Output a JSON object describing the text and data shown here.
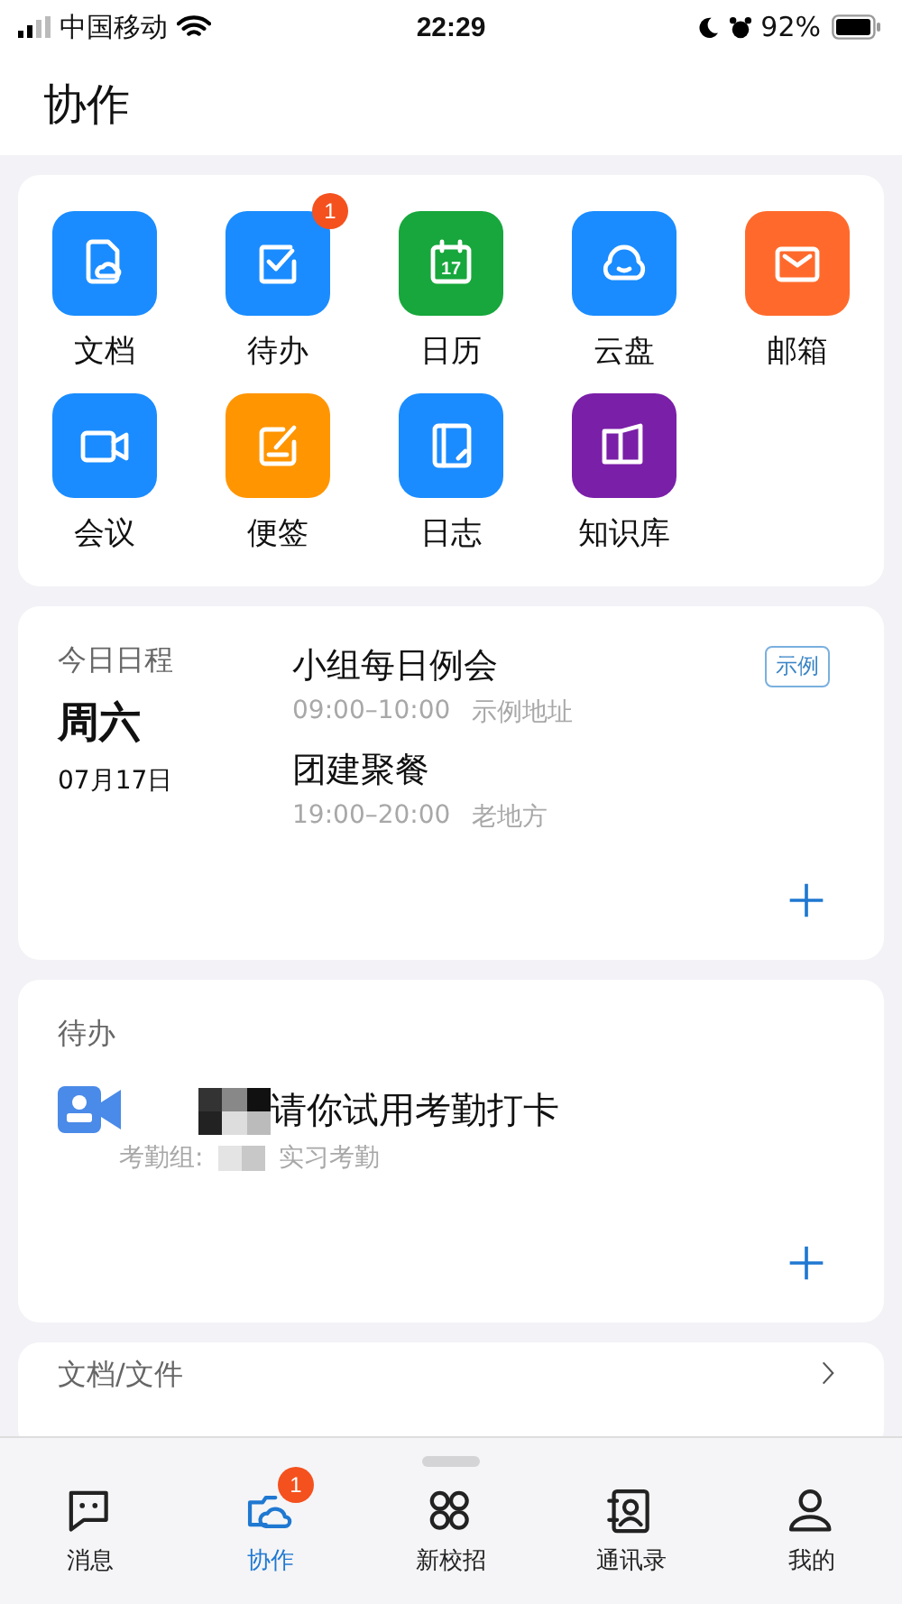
{
  "status_bar": {
    "carrier": "中国移动",
    "time": "22:29",
    "battery": "92%"
  },
  "header": {
    "title": "协作"
  },
  "apps": [
    {
      "label": "文档",
      "kind": "doc",
      "color": "#1a8cff"
    },
    {
      "label": "待办",
      "kind": "todo",
      "color": "#1a8cff",
      "badge": "1"
    },
    {
      "label": "日历",
      "kind": "calendar",
      "color": "#17a73c",
      "icon_text": "17"
    },
    {
      "label": "云盘",
      "kind": "cloud",
      "color": "#1a8cff"
    },
    {
      "label": "邮箱",
      "kind": "mail",
      "color": "#ff6a2c"
    },
    {
      "label": "会议",
      "kind": "video",
      "color": "#1a8cff"
    },
    {
      "label": "便签",
      "kind": "note",
      "color": "#ff9500"
    },
    {
      "label": "日志",
      "kind": "journal",
      "color": "#1a8cff"
    },
    {
      "label": "知识库",
      "kind": "book",
      "color": "#7a1fa8"
    }
  ],
  "schedule": {
    "title": "今日日程",
    "weekday": "周六",
    "date": "07月17日",
    "events": [
      {
        "title": "小组每日例会",
        "time": "09:00–10:00",
        "place": "示例地址",
        "tag": "示例"
      },
      {
        "title": "团建聚餐",
        "time": "19:00–20:00",
        "place": "老地方"
      }
    ]
  },
  "todo": {
    "title": "待办",
    "items": [
      {
        "title": "请你试用考勤打卡",
        "group_label": "考勤组:",
        "group": "实习考勤"
      }
    ]
  },
  "docs": {
    "title": "文档/文件"
  },
  "tabs": [
    {
      "label": "消息",
      "kind": "chat",
      "selected": false
    },
    {
      "label": "协作",
      "kind": "collab",
      "selected": true,
      "badge": "1"
    },
    {
      "label": "新校招",
      "kind": "apps",
      "selected": false
    },
    {
      "label": "通讯录",
      "kind": "contacts",
      "selected": false
    },
    {
      "label": "我的",
      "kind": "person",
      "selected": false
    }
  ]
}
